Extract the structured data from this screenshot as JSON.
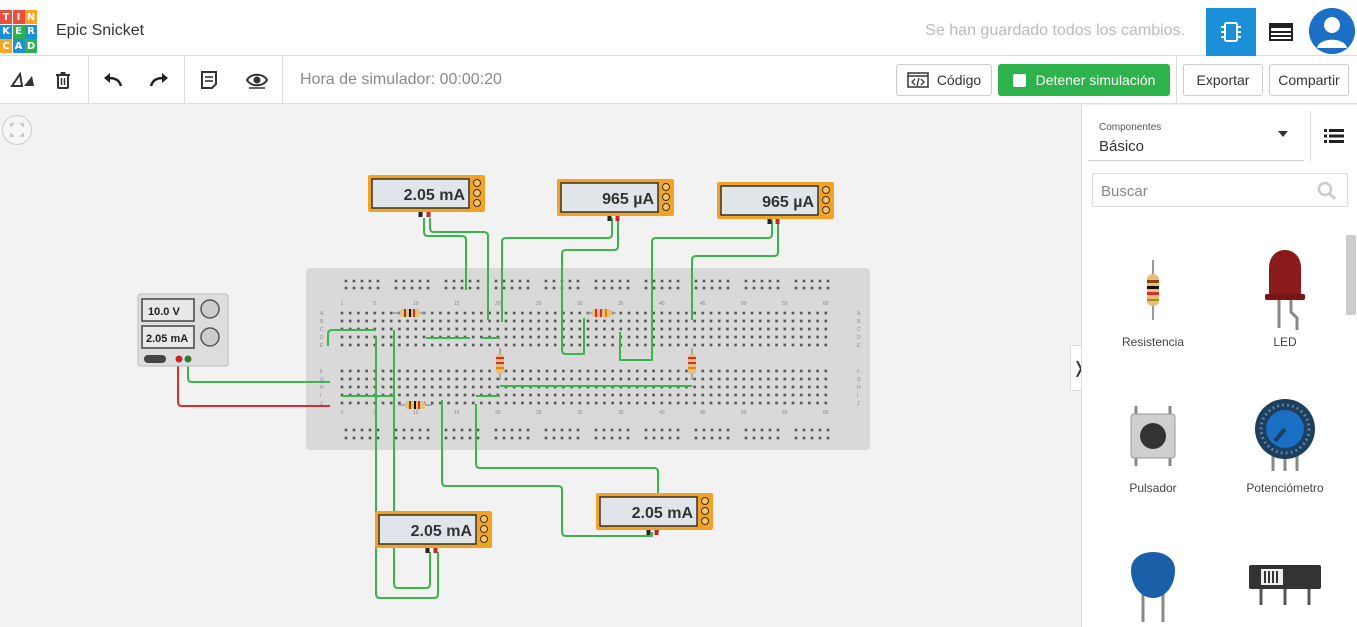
{
  "app": {
    "logo_letters": [
      "T",
      "I",
      "N",
      "K",
      "E",
      "R",
      "C",
      "A",
      "D"
    ],
    "logo_colors": [
      "#e94f3d",
      "#e94f3d",
      "#f6a623",
      "#1b8fd7",
      "#2db24c",
      "#1b8fd7",
      "#f6a623",
      "#1b8fd7",
      "#2db24c"
    ],
    "project_name": "Epic Snicket",
    "save_status": "Se han guardado todos los cambios."
  },
  "toolbar": {
    "sim_time": "Hora de simulador: 00:00:20",
    "code_label": "Código",
    "stop_label": "Detener simulación",
    "export_label": "Exportar",
    "share_label": "Compartir"
  },
  "circuit": {
    "power_supply": {
      "voltage": "10.0 V",
      "current": "2.05 mA"
    },
    "meters": [
      "2.05 mA",
      "965 µA",
      "965 µA",
      "2.05 mA",
      "2.05 mA"
    ],
    "row_letters": [
      "A",
      "B",
      "C",
      "D",
      "E",
      "F",
      "G",
      "H",
      "I",
      "J"
    ],
    "col_numbers": [
      "1",
      "5",
      "10",
      "15",
      "20",
      "25",
      "30",
      "35",
      "40",
      "45",
      "50",
      "55",
      "60"
    ]
  },
  "panel": {
    "select_label": "Componentes",
    "select_value": "Básico",
    "search_placeholder": "Buscar",
    "components": [
      "Resistencia",
      "LED",
      "Pulsador",
      "Potenciómetro",
      "",
      ""
    ]
  },
  "colors": {
    "accent": "#1b8fd7",
    "sim_green": "#2db24c",
    "wire_green": "#3bb54a",
    "wire_red": "#d32f2f",
    "meter_orange": "#f4a223"
  }
}
